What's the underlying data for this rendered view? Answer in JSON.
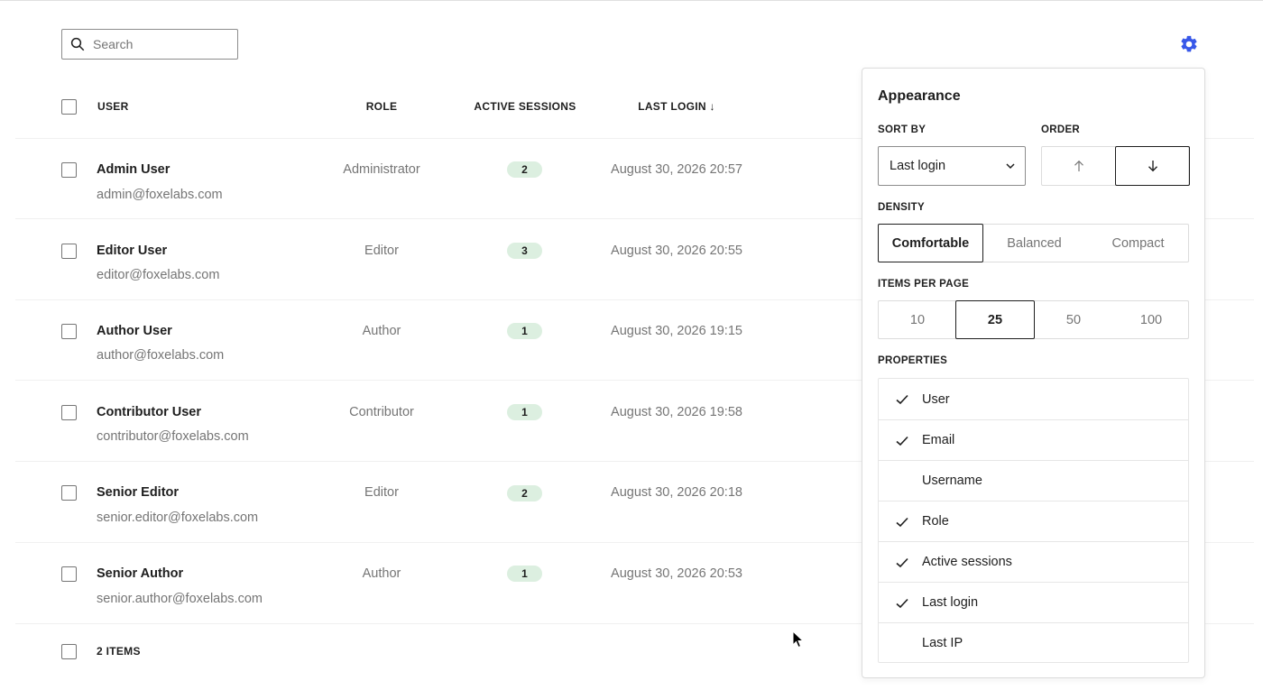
{
  "search": {
    "placeholder": "Search"
  },
  "table": {
    "columns": {
      "user": "USER",
      "role": "ROLE",
      "active_sessions": "ACTIVE SESSIONS",
      "last_login": "LAST LOGIN ↓"
    },
    "rows": [
      {
        "name": "Admin User",
        "email": "admin@foxelabs.com",
        "role": "Administrator",
        "sessions": "2",
        "last_login": "August 30, 2026 20:57"
      },
      {
        "name": "Editor User",
        "email": "editor@foxelabs.com",
        "role": "Editor",
        "sessions": "3",
        "last_login": "August 30, 2026 20:55"
      },
      {
        "name": "Author User",
        "email": "author@foxelabs.com",
        "role": "Author",
        "sessions": "1",
        "last_login": "August 30, 2026 19:15"
      },
      {
        "name": "Contributor User",
        "email": "contributor@foxelabs.com",
        "role": "Contributor",
        "sessions": "1",
        "last_login": "August 30, 2026 19:58"
      },
      {
        "name": "Senior Editor",
        "email": "senior.editor@foxelabs.com",
        "role": "Editor",
        "sessions": "2",
        "last_login": "August 30, 2026 20:18"
      },
      {
        "name": "Senior Author",
        "email": "senior.author@foxelabs.com",
        "role": "Author",
        "sessions": "1",
        "last_login": "August 30, 2026 20:53"
      }
    ],
    "footer": "2 ITEMS"
  },
  "appearance": {
    "title": "Appearance",
    "sort_by_label": "SORT BY",
    "sort_by_value": "Last login",
    "order_label": "ORDER",
    "order_selected": "descending",
    "density_label": "DENSITY",
    "density_options": [
      "Comfortable",
      "Balanced",
      "Compact"
    ],
    "density_selected": "Comfortable",
    "items_per_page_label": "ITEMS PER PAGE",
    "items_per_page_options": [
      "10",
      "25",
      "50",
      "100"
    ],
    "items_per_page_selected": "25",
    "properties_label": "PROPERTIES",
    "properties": [
      {
        "label": "User",
        "checked": true
      },
      {
        "label": "Email",
        "checked": true
      },
      {
        "label": "Username",
        "checked": false
      },
      {
        "label": "Role",
        "checked": true
      },
      {
        "label": "Active sessions",
        "checked": true
      },
      {
        "label": "Last login",
        "checked": true
      },
      {
        "label": "Last IP",
        "checked": false
      }
    ]
  },
  "colors": {
    "accent": "#3858e9",
    "badge_bg": "#dcefe0",
    "muted_text": "#757575"
  },
  "icons": {
    "search": "search-icon",
    "settings": "gear-icon",
    "sort_asc": "arrow-up-icon",
    "sort_desc": "arrow-down-icon",
    "check": "check-icon",
    "dropdown": "chevron-down-icon"
  }
}
